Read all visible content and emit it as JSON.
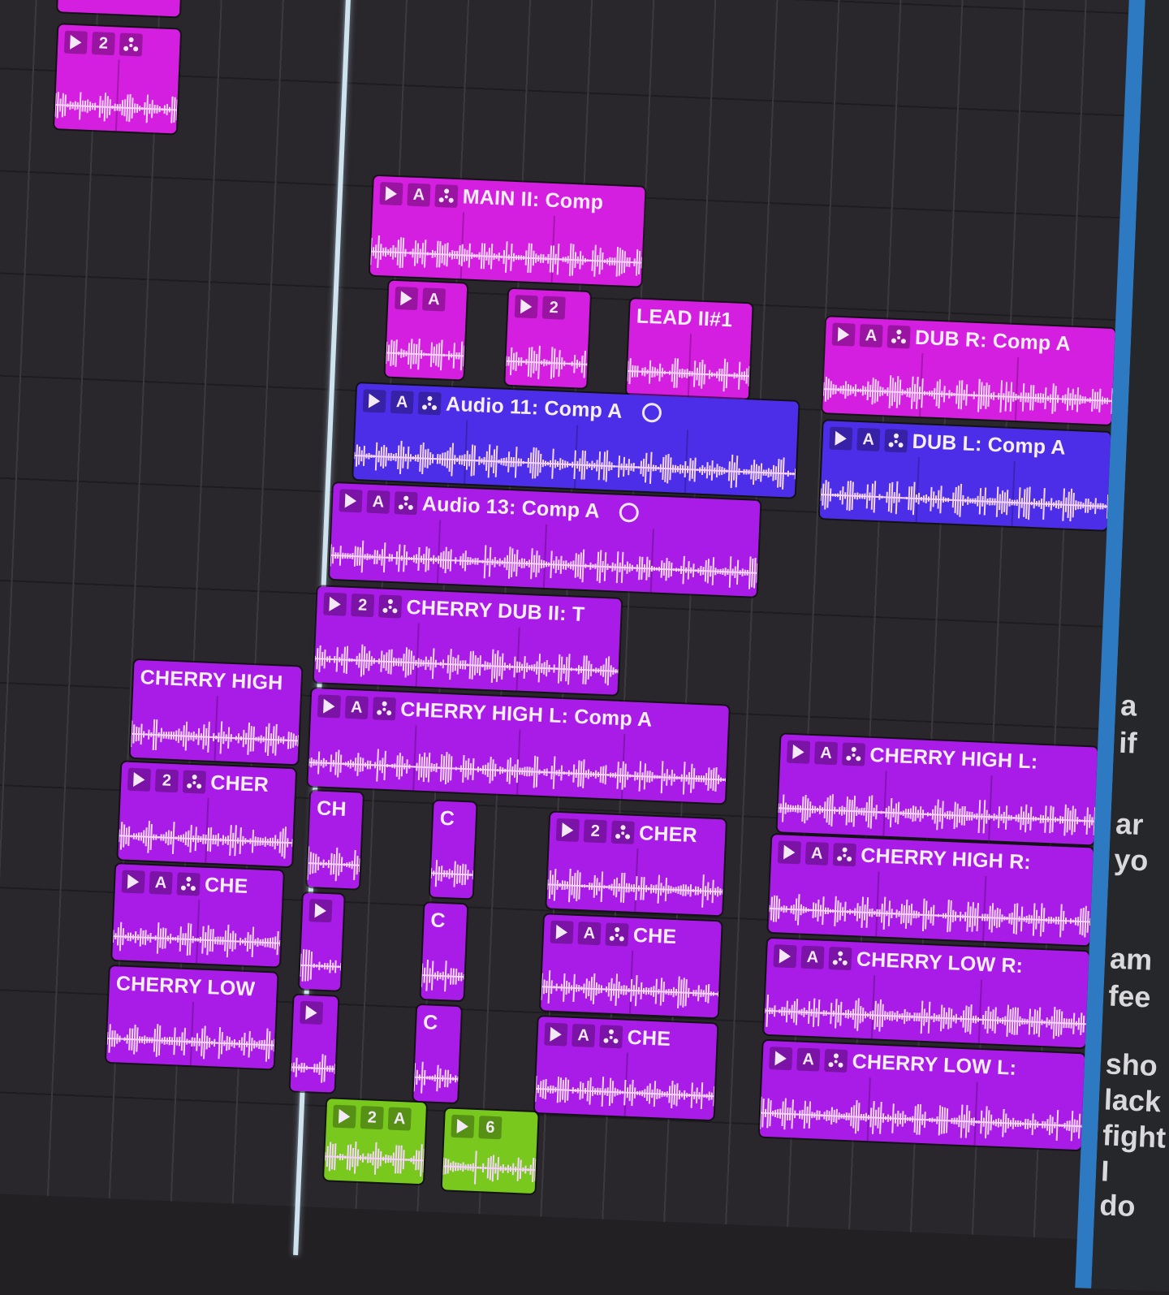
{
  "colors": {
    "magenta": "#d41ee0",
    "violet": "#a91be6",
    "blue": "#4c2ee8",
    "green": "#78c81e",
    "panel_edge": "#2d79c2"
  },
  "regions": {
    "r_top_small": {
      "buttons": [
        "▶",
        "2",
        "flex"
      ],
      "name": ""
    },
    "main_ii": {
      "buttons": [
        "▶",
        "A",
        "flex"
      ],
      "name": "MAIN II: Comp"
    },
    "small_a": {
      "buttons": [
        "▶",
        "A"
      ],
      "name": ""
    },
    "small_2": {
      "buttons": [
        "▶",
        "2"
      ],
      "name": ""
    },
    "lead": {
      "buttons": [],
      "name": "LEAD II#1"
    },
    "dub_r": {
      "buttons": [
        "▶",
        "A",
        "flex"
      ],
      "name": "DUB R: Comp A"
    },
    "audio11": {
      "buttons": [
        "▶",
        "A",
        "flex"
      ],
      "name": "Audio 11: Comp A"
    },
    "dub_l": {
      "buttons": [
        "▶",
        "A",
        "flex"
      ],
      "name": "DUB L: Comp A"
    },
    "audio13": {
      "buttons": [
        "▶",
        "A",
        "flex"
      ],
      "name": "Audio 13: Comp A"
    },
    "cherry_dub": {
      "buttons": [
        "▶",
        "2",
        "flex"
      ],
      "name": "CHERRY DUB II: T"
    },
    "cherry_high_left": {
      "buttons": [],
      "name": "CHERRY HIGH"
    },
    "cherry_high_l": {
      "buttons": [
        "▶",
        "A",
        "flex"
      ],
      "name": "CHERRY HIGH L: Comp A"
    },
    "cherry_high_l_right": {
      "buttons": [
        "▶",
        "A",
        "flex"
      ],
      "name": "CHERRY HIGH L:"
    },
    "cher_left": {
      "buttons": [
        "▶",
        "2",
        "flex"
      ],
      "name": "CHER"
    },
    "ch_small": {
      "buttons": [],
      "name": "CH"
    },
    "c1": {
      "buttons": [],
      "name": "C"
    },
    "cher_mid": {
      "buttons": [
        "▶",
        "2",
        "flex"
      ],
      "name": "CHER"
    },
    "cherry_high_r": {
      "buttons": [
        "▶",
        "A",
        "flex"
      ],
      "name": "CHERRY HIGH R:"
    },
    "che_left": {
      "buttons": [
        "▶",
        "A",
        "flex"
      ],
      "name": "CHE"
    },
    "p_small1": {
      "buttons": [
        "▶"
      ],
      "name": ""
    },
    "c2": {
      "buttons": [],
      "name": "C"
    },
    "che_mid1": {
      "buttons": [
        "▶",
        "A",
        "flex"
      ],
      "name": "CHE"
    },
    "cherry_low_r": {
      "buttons": [
        "▶",
        "A",
        "flex"
      ],
      "name": "CHERRY LOW R:"
    },
    "cherry_low_left": {
      "buttons": [],
      "name": "CHERRY LOW"
    },
    "p_small2": {
      "buttons": [
        "▶"
      ],
      "name": ""
    },
    "c3": {
      "buttons": [],
      "name": "C"
    },
    "che_mid2": {
      "buttons": [
        "▶",
        "A",
        "flex"
      ],
      "name": "CHE"
    },
    "cherry_low_l": {
      "buttons": [
        "▶",
        "A",
        "flex"
      ],
      "name": "CHERRY LOW L:"
    },
    "green1": {
      "buttons": [
        "▶",
        "2",
        "A"
      ],
      "name": ""
    },
    "green2": {
      "buttons": [
        "▶",
        "6"
      ],
      "name": ""
    }
  },
  "side_panel": {
    "lines": [
      "a",
      "if",
      "ar",
      "yo",
      "am",
      "fee",
      "sho",
      "lack",
      "fight",
      "I do"
    ]
  }
}
